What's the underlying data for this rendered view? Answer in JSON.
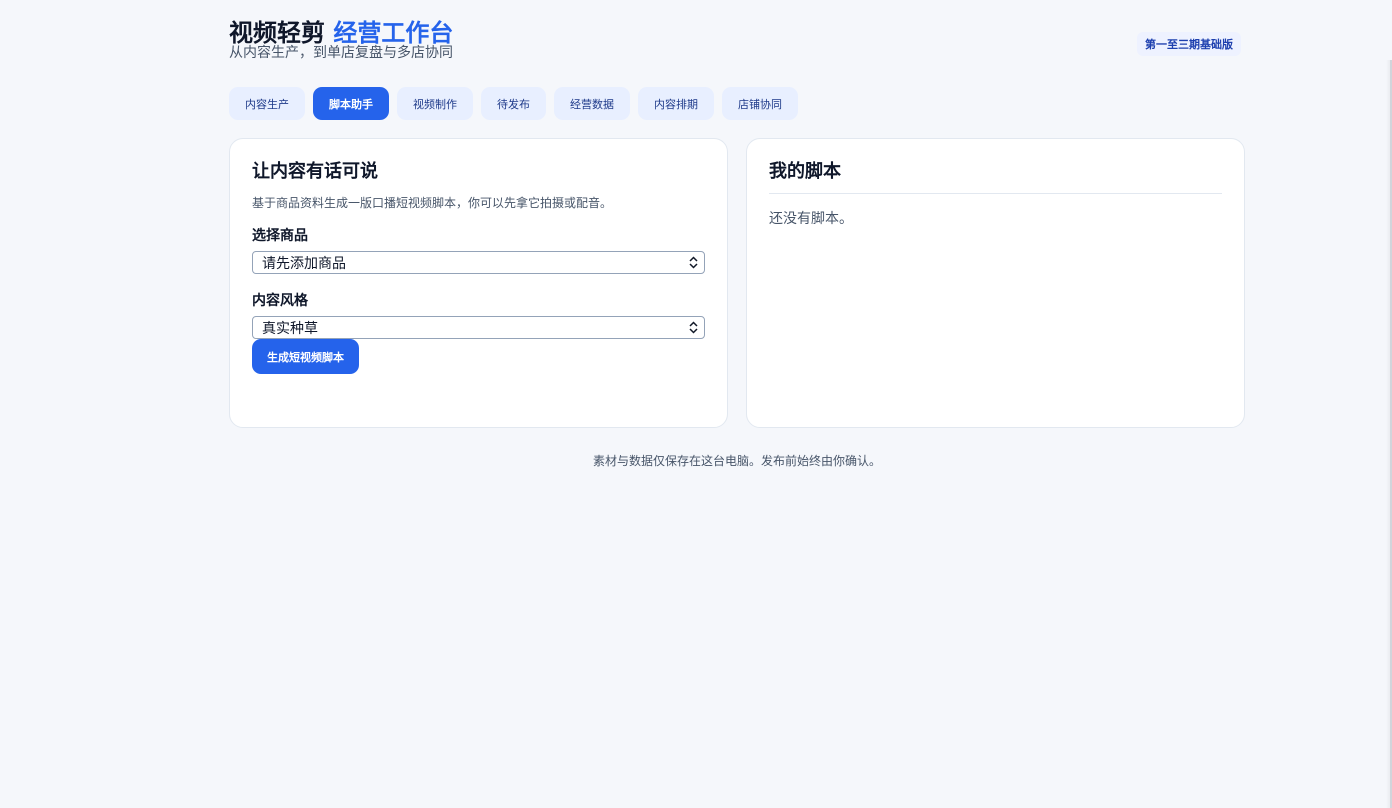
{
  "header": {
    "title_main": "视频轻剪",
    "title_accent": "经营工作台",
    "subtitle": "从内容生产，到单店复盘与多店协同",
    "version_badge": "第一至三期基础版"
  },
  "tabs": [
    {
      "label": "内容生产",
      "active": false
    },
    {
      "label": "脚本助手",
      "active": true
    },
    {
      "label": "视频制作",
      "active": false
    },
    {
      "label": "待发布",
      "active": false
    },
    {
      "label": "经营数据",
      "active": false
    },
    {
      "label": "内容排期",
      "active": false
    },
    {
      "label": "店铺协同",
      "active": false
    }
  ],
  "left_panel": {
    "title": "让内容有话可说",
    "description": "基于商品资料生成一版口播短视频脚本，你可以先拿它拍摄或配音。",
    "product_label": "选择商品",
    "product_value": "请先添加商品",
    "style_label": "内容风格",
    "style_value": "真实种草",
    "generate_button": "生成短视频脚本"
  },
  "right_panel": {
    "title": "我的脚本",
    "empty_text": "还没有脚本。"
  },
  "footer": {
    "note": "素材与数据仅保存在这台电脑。发布前始终由你确认。"
  },
  "colors": {
    "accent": "#2563eb",
    "background": "#f5f7fb",
    "tab_inactive_bg": "#e8efff"
  },
  "icons": {
    "select_arrow": "chevron-up-down-icon"
  }
}
